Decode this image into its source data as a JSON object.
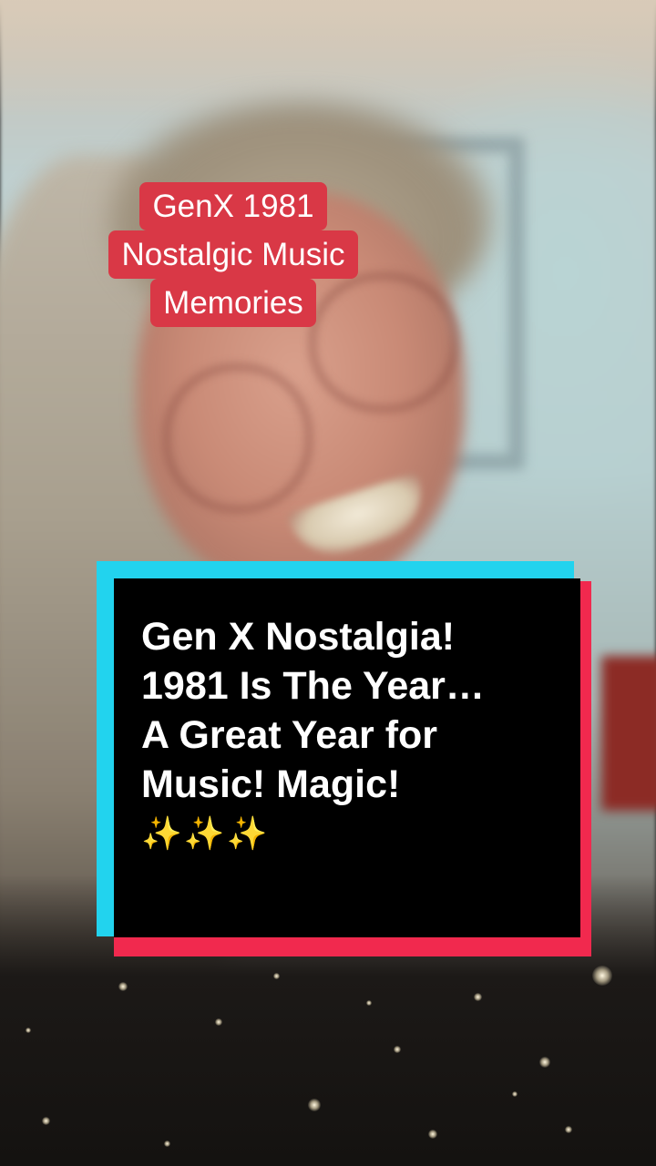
{
  "overlay_label": {
    "lines": [
      "GenX 1981",
      "Nostalgic Music",
      "Memories"
    ],
    "color": "#d93846"
  },
  "caption": {
    "lines": [
      "Gen X Nostalgia!",
      "1981 Is The Year…",
      "A Great Year for",
      "Music! Magic!",
      "✨✨✨"
    ],
    "colors": {
      "box": "#000000",
      "glitch_cyan": "#22d3ee",
      "glitch_red": "#f1294e",
      "text": "#ffffff"
    }
  }
}
